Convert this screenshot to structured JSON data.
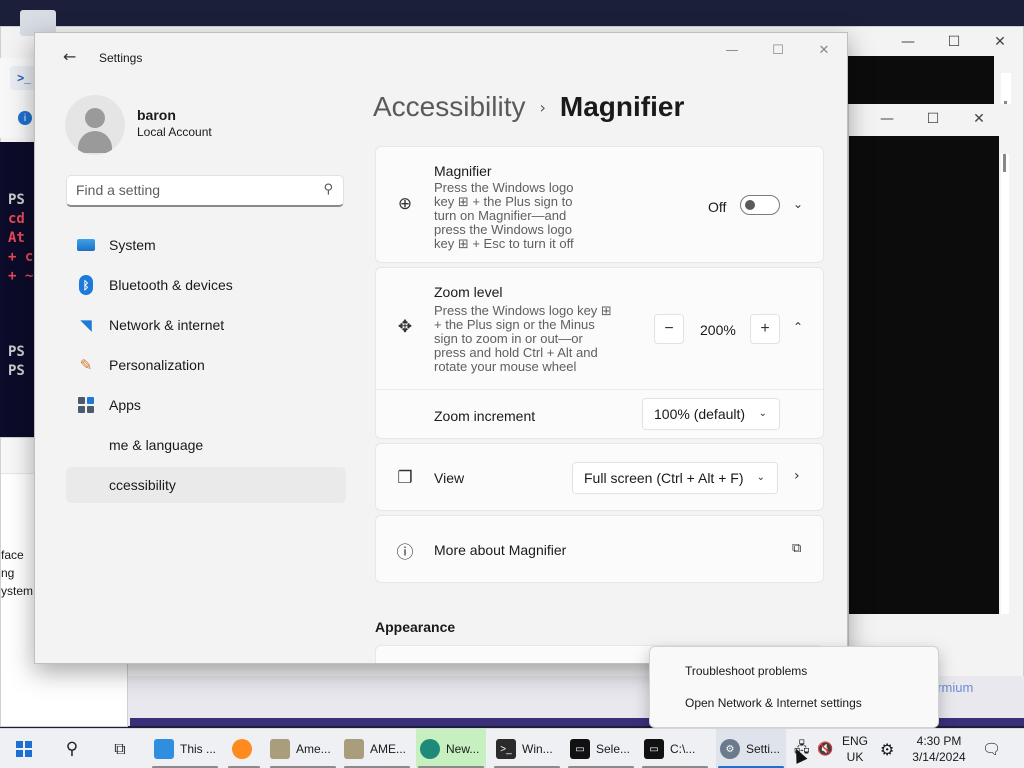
{
  "background": {
    "terminal_lines": [
      "PS",
      "cd",
      "At",
      "+ c",
      "+ ~",
      "",
      "",
      "",
      "PS",
      "PS"
    ],
    "termium_text": "ermium",
    "left_dialog_lines": [
      "face",
      "ng",
      "ystem."
    ]
  },
  "window": {
    "title": "Settings"
  },
  "user": {
    "name": "baron",
    "account_type": "Local Account"
  },
  "search": {
    "placeholder": "Find a setting"
  },
  "sidebar": {
    "items": [
      {
        "label": "System",
        "icon": "monitor-icon"
      },
      {
        "label": "Bluetooth & devices",
        "icon": "bluetooth-icon"
      },
      {
        "label": "Network & internet",
        "icon": "wifi-icon"
      },
      {
        "label": "Personalization",
        "icon": "paintbrush-icon"
      },
      {
        "label": "Apps",
        "icon": "apps-icon"
      },
      {
        "label": "me & language",
        "icon": "globe-icon"
      },
      {
        "label": "ccessibility",
        "icon": "accessibility-icon"
      }
    ]
  },
  "breadcrumb": {
    "parent": "Accessibility",
    "separator": "›",
    "current": "Magnifier"
  },
  "magnifier_card": {
    "title": "Magnifier",
    "description_lines": [
      "Press the Windows logo",
      "key ⊞ + the Plus sign to",
      "turn on Magnifier—and",
      "press the Windows logo",
      "key ⊞ + Esc to turn it off"
    ],
    "toggle_label": "Off",
    "toggle_state": "off"
  },
  "zoom_card": {
    "title": "Zoom level",
    "description_lines": [
      "Press the Windows logo key ⊞",
      "+ the Plus sign or the Minus",
      "sign to zoom in or out—or",
      "press and hold Ctrl + Alt and",
      "rotate your mouse wheel"
    ],
    "minus_label": "−",
    "value": "200%",
    "plus_label": "+",
    "increment_label": "Zoom increment",
    "increment_value": "100% (default)"
  },
  "view_card": {
    "title": "View",
    "value": "Full screen (Ctrl + Alt + F)"
  },
  "more_card": {
    "title": "More about Magnifier"
  },
  "appearance": {
    "title": "Appearance"
  },
  "context_menu": {
    "items": [
      "Troubleshoot problems",
      "Open Network & Internet settings"
    ]
  },
  "taskbar": {
    "apps": [
      {
        "label": "This ...",
        "icon": "this-pc-icon"
      },
      {
        "label": "",
        "icon": "firefox-icon"
      },
      {
        "label": "Ame...",
        "icon": "package-icon"
      },
      {
        "label": "AME...",
        "icon": "package-icon"
      },
      {
        "label": "New...",
        "icon": "edge-icon"
      },
      {
        "label": "Win...",
        "icon": "powershell-icon"
      },
      {
        "label": "Sele...",
        "icon": "console-icon"
      },
      {
        "label": "C:\\...",
        "icon": "console-icon"
      },
      {
        "label": "Setti...",
        "icon": "settings-gear-icon"
      }
    ],
    "language": [
      "ENG",
      "UK"
    ],
    "time": "4:30 PM",
    "date": "3/14/2024"
  },
  "colors": {
    "accent": "#1d6fd1",
    "window_bg": "#f3f3f3",
    "card_bg": "#fbfbfb",
    "terminal_red": "#e74856"
  }
}
